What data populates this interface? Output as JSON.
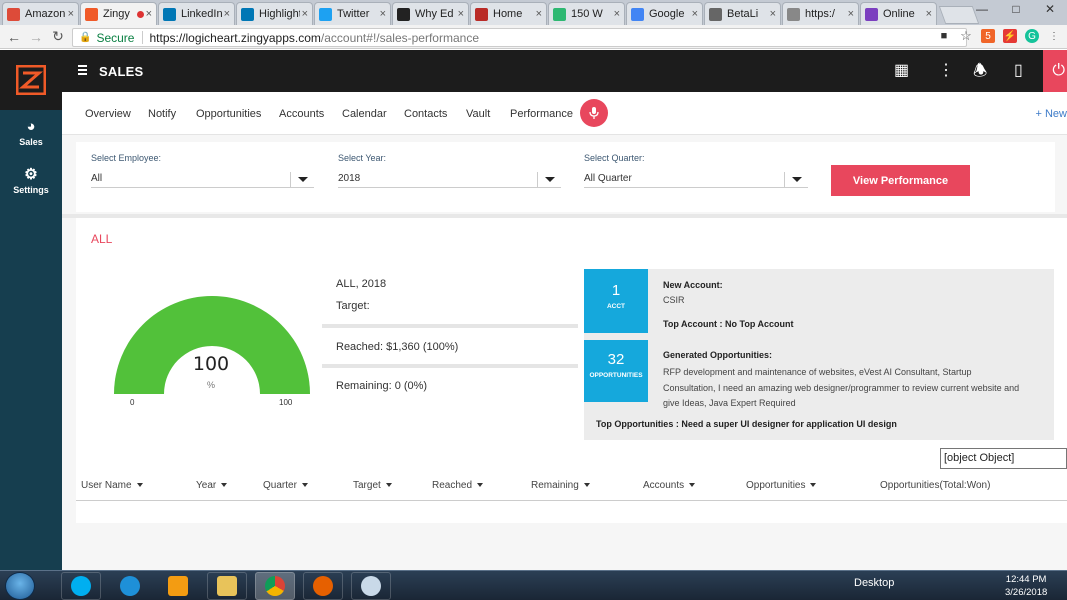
{
  "browser": {
    "tabs": [
      {
        "title": "Amazon",
        "icon": "gmail-icon",
        "color": "#dd4b39",
        "active": false
      },
      {
        "title": "Zingy",
        "icon": "zingy-icon",
        "color": "#f05a28",
        "active": true
      },
      {
        "title": "LinkedIn",
        "icon": "linkedin-icon",
        "color": "#0077b5",
        "active": false
      },
      {
        "title": "Highlights",
        "icon": "linkedin-icon",
        "color": "#0077b5",
        "active": false
      },
      {
        "title": "Twitter",
        "icon": "twitter-icon",
        "color": "#1da1f2",
        "active": false
      },
      {
        "title": "Why Ed",
        "icon": "f-icon",
        "color": "#222222",
        "active": false
      },
      {
        "title": "Home",
        "icon": "quora-icon",
        "color": "#b92b27",
        "active": false
      },
      {
        "title": "150 W",
        "icon": "green-icon",
        "color": "#2eb872",
        "active": false
      },
      {
        "title": "Google",
        "icon": "google-docs-icon",
        "color": "#4285f4",
        "active": false
      },
      {
        "title": "BetaLi",
        "icon": "doc-icon",
        "color": "#666666",
        "active": false
      },
      {
        "title": "https:/",
        "icon": "page-icon",
        "color": "#888888",
        "active": false
      },
      {
        "title": "Online",
        "icon": "grid-icon",
        "color": "#7b3fbf",
        "active": false
      }
    ],
    "url_secure": "Secure",
    "url_host": "https://logicheart.zingyapps.com",
    "url_path": "/account#!/sales-performance"
  },
  "sidebar": {
    "items": [
      {
        "label": "Sales",
        "icon": "speedometer-icon"
      },
      {
        "label": "Settings",
        "icon": "gear-icon"
      }
    ]
  },
  "topbar": {
    "title": "SALES"
  },
  "nav": {
    "tabs": [
      "Overview",
      "Notify",
      "Opportunities",
      "Accounts",
      "Calendar",
      "Contacts",
      "Vault",
      "Performance"
    ],
    "new_link": "+ New"
  },
  "filters": {
    "employee_label": "Select Employee:",
    "employee_value": "All",
    "year_label": "Select Year:",
    "year_value": "2018",
    "quarter_label": "Select Quarter:",
    "quarter_value": "All Quarter",
    "button": "View Performance"
  },
  "perf": {
    "heading": "ALL",
    "gauge_value": "100",
    "gauge_unit": "%",
    "gauge_fill": 1.0,
    "gauge_min": "0",
    "gauge_max": "100",
    "period": "ALL, 2018",
    "target": "Target:",
    "reached": "Reached: $1,360 (100%)",
    "remaining": "Remaining: 0 (0%)"
  },
  "info": {
    "acct_count": "1",
    "acct_label": "ACCT",
    "new_account_label": "New Account:",
    "new_account_value": "CSIR",
    "top_account": "Top Account : No Top Account",
    "opp_count": "32",
    "opp_label": "OPPORTUNITIES",
    "generated_label": "Generated Opportunities:",
    "generated_lines": [
      "RFP development and maintenance of websites, eVest AI Consultant, Startup",
      "Consultation, I need an amazing web designer/programmer to review current website and",
      "give Ideas, Java Expert Required"
    ],
    "top_opportunities": "Top Opportunities : Need a super UI designer for application UI design"
  },
  "table": {
    "object_box": "[object Object]",
    "columns": [
      "User Name",
      "Year",
      "Quarter",
      "Target",
      "Reached",
      "Remaining",
      "Accounts",
      "Opportunities",
      "Opportunities(Total:Won)"
    ]
  },
  "taskbar": {
    "desktop": "Desktop",
    "time": "12:44 PM",
    "date": "3/26/2018"
  },
  "colors": {
    "accent": "#e8475d",
    "info_blue": "#15a8dc",
    "gauge_green": "#52c13a",
    "sidebar": "#163e4f"
  }
}
